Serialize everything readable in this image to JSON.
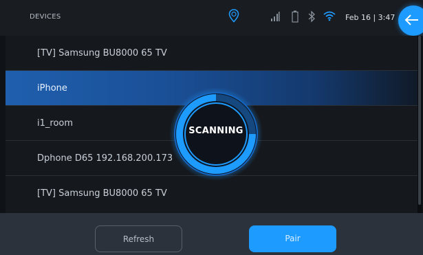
{
  "header": {
    "title": "DEVICES",
    "datetime": "Feb 16 | 3:47",
    "icons": [
      "location-pin-icon",
      "signal-icon",
      "battery-icon",
      "bluetooth-icon",
      "wifi-icon",
      "back-arrow-icon"
    ]
  },
  "devices": [
    {
      "label": "[TV] Samsung BU8000 65 TV",
      "selected": false
    },
    {
      "label": "iPhone",
      "selected": true
    },
    {
      "label": "i1_room",
      "selected": false
    },
    {
      "label": "Dphone D65 192.168.200.173",
      "selected": false
    },
    {
      "label": "[TV] Samsung BU8000 65 TV",
      "selected": false
    }
  ],
  "scan": {
    "label": "SCANNING"
  },
  "actions": {
    "refresh_label": "Refresh",
    "pair_label": "Pair"
  },
  "colors": {
    "accent": "#1e9bff",
    "background": "#0f1216",
    "bottom_bar": "#2b323c"
  }
}
